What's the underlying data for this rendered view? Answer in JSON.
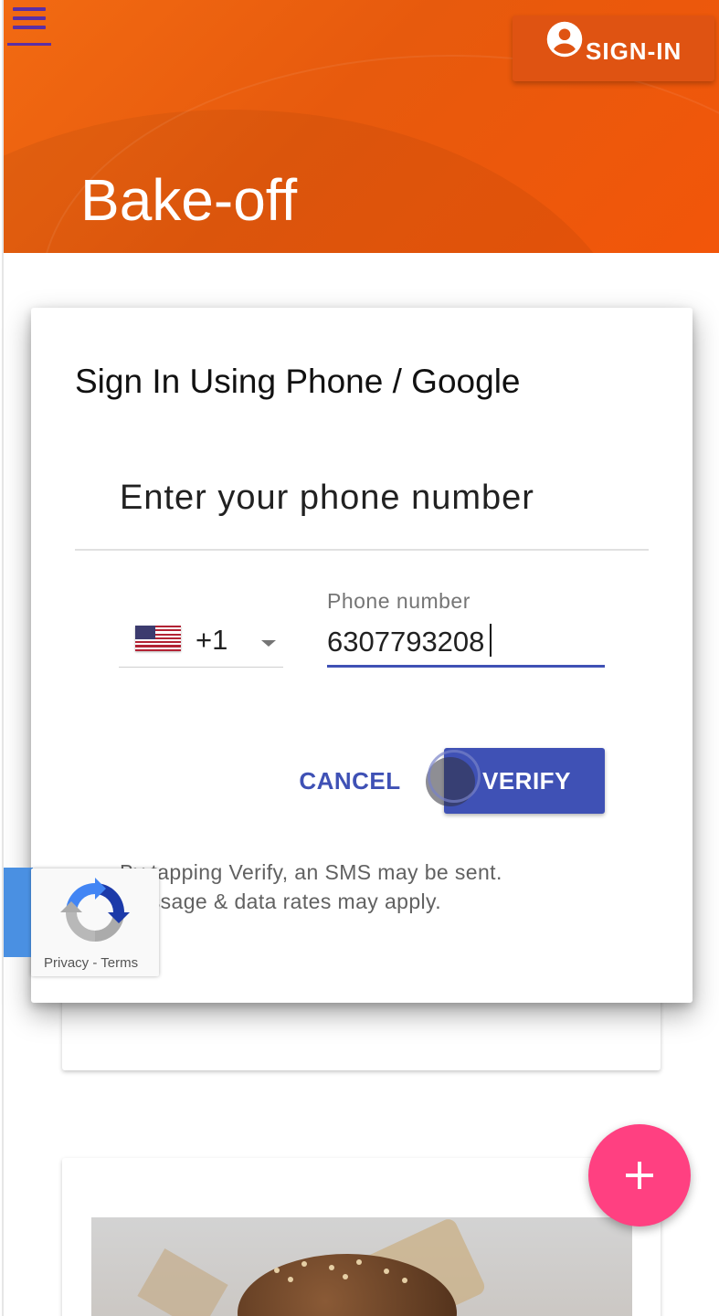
{
  "header": {
    "app_title": "Bake-off",
    "signin_label": "SIGN-IN"
  },
  "dialog": {
    "title": "Sign In Using Phone / Google",
    "heading": "Enter your phone number",
    "country": {
      "flag": "us-flag-icon",
      "dial_code": "+1"
    },
    "phone_field": {
      "label": "Phone number",
      "value": "6307793208"
    },
    "buttons": {
      "cancel": "CANCEL",
      "verify": "VERIFY"
    },
    "disclaimer_line1": "By tapping Verify, an SMS may be sent.",
    "disclaimer_line2": "Message & data rates may apply."
  },
  "recaptcha": {
    "links": "Privacy - Terms"
  },
  "colors": {
    "header": "#e8590c",
    "primary": "#3f51b5",
    "fab": "#ff4081",
    "menu": "#5b2fa5"
  },
  "icons": [
    "menu-icon",
    "account-circle-icon",
    "us-flag-icon",
    "dropdown-caret-icon",
    "recaptcha-logo-icon",
    "plus-icon"
  ]
}
